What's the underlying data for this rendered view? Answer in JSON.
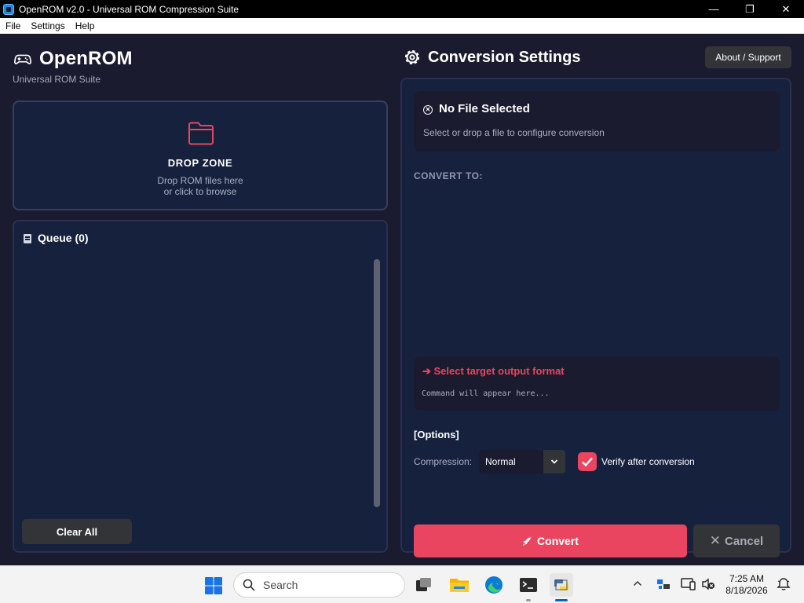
{
  "window": {
    "title": "OpenROM v2.0 - Universal ROM Compression Suite",
    "controls": {
      "minimize": "—",
      "maximize": "❐",
      "close": "✕"
    }
  },
  "menu": {
    "items": [
      "File",
      "Settings",
      "Help"
    ]
  },
  "brand": {
    "title": "OpenROM",
    "subtitle": "Universal ROM Suite",
    "icon": "gamepad-icon"
  },
  "dropzone": {
    "title": "DROP ZONE",
    "line1": "Drop ROM files here",
    "line2": "or click to browse",
    "icon": "folder-icon"
  },
  "queue": {
    "title": "Queue (0)",
    "clear_label": "Clear All",
    "icon": "clipboard-icon"
  },
  "settings": {
    "title": "Conversion Settings",
    "about_label": "About / Support",
    "icon": "gear-icon",
    "file": {
      "title": "No File Selected",
      "subtitle": "Select or drop a file to configure conversion"
    },
    "convert_to_label": "CONVERT TO:",
    "command": {
      "title": "➔ Select target output format",
      "text": "Command will appear here..."
    },
    "options_label": "[Options]",
    "compression": {
      "label": "Compression:",
      "value": "Normal"
    },
    "verify": {
      "label": "Verify after conversion",
      "checked": true
    },
    "convert_label": "Convert",
    "cancel_label": "Cancel",
    "progress": 0.01
  },
  "taskbar": {
    "search_placeholder": "Search",
    "time": "7:25 AM",
    "date": "8/18/2026"
  },
  "colors": {
    "accent": "#e94560",
    "panel": "#16213e",
    "background": "#1a1b2e",
    "button_dark": "#333437"
  }
}
